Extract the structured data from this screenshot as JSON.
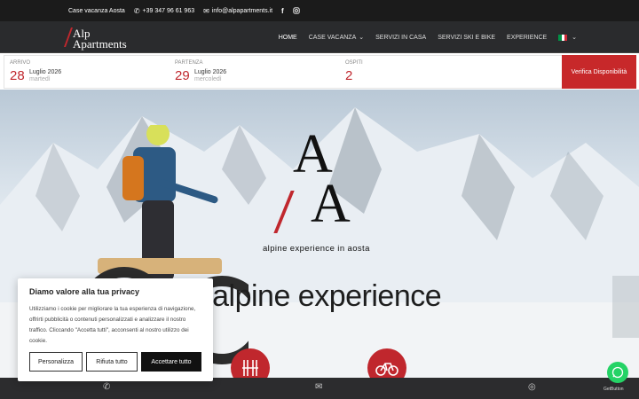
{
  "topbar": {
    "title": "Case vacanza Aosta",
    "phone": "+39 347 96 61 963",
    "email": "info@alpapartments.it",
    "icons": [
      "phone-icon",
      "mail-icon",
      "facebook-icon",
      "instagram-icon"
    ]
  },
  "logo": {
    "line1": "Alp",
    "line2": "Apartments"
  },
  "menu": {
    "items": [
      "HOME",
      "CASE VACANZA",
      "SERVIZI IN CASA",
      "SERVIZI SKI E BIKE",
      "EXPERIENCE"
    ],
    "language_icon": "italian-flag-icon"
  },
  "booking": {
    "arrival": {
      "label": "ARRIVO",
      "day": "28",
      "month": "Luglio 2026",
      "weekday": "martedì"
    },
    "departure": {
      "label": "PARTENZA",
      "day": "29",
      "month": "Luglio 2026",
      "weekday": "mercoledì"
    },
    "guests": {
      "label": "OSPITI",
      "value": "2"
    },
    "check_button": "Verifica Disponibilità"
  },
  "hero": {
    "logo_letter": "A",
    "logo_tagline": "alpine experience in aosta",
    "headline": "la tua alpine experience"
  },
  "cookie": {
    "title": "Diamo valore alla tua privacy",
    "text": "Utilizziamo i cookie per migliorare la tua esperienza di navigazione, offrirti pubblicità o contenuti personalizzati e analizzare il nostro traffico. Cliccando \"Accetta tutti\", acconsenti al nostro utilizzo dei cookie.",
    "btn_customize": "Personalizza",
    "btn_reject": "Rifiuta tutto",
    "btn_accept": "Accettare tutto"
  },
  "whatsapp_label": "GetButton",
  "colors": {
    "accent": "#c0272d",
    "dark": "#1b1b1b",
    "whatsapp": "#25d366"
  }
}
